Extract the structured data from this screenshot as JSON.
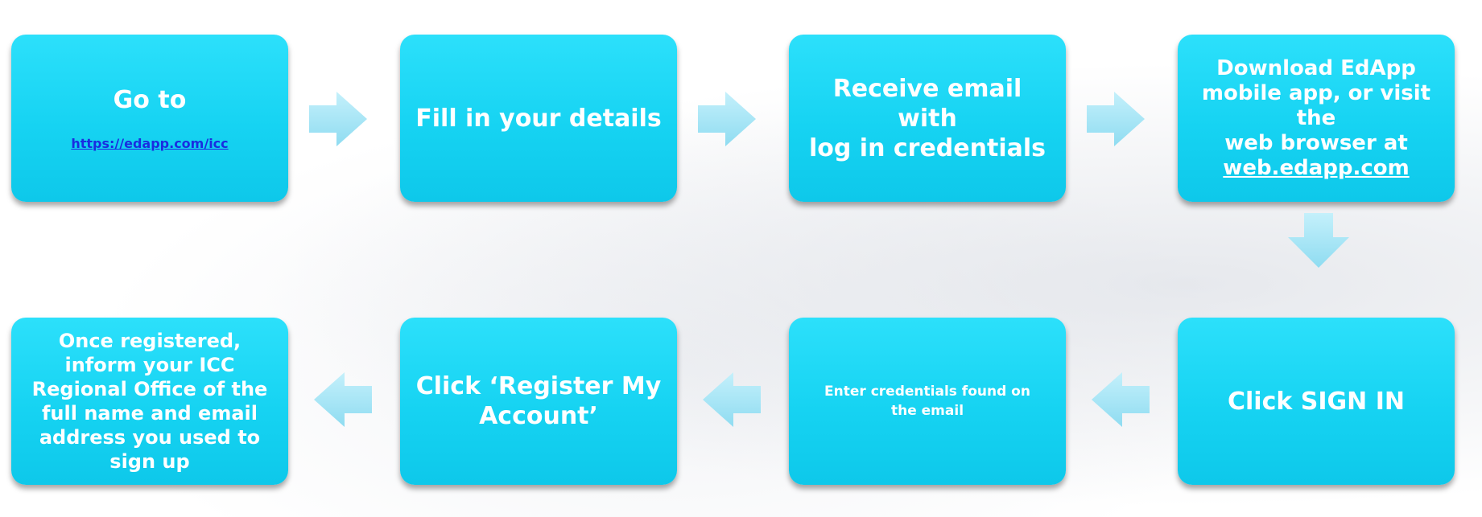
{
  "steps": {
    "go_to": {
      "title": "Go to",
      "link": "https://edapp.com/icc"
    },
    "fill": {
      "text": "Fill in your details"
    },
    "receive": {
      "line1": "Receive email with",
      "line2": "log in credentials"
    },
    "download": {
      "line1": "Download EdApp",
      "line2": "mobile app, or visit the",
      "line3": "web browser at",
      "link": "web.edapp.com"
    },
    "sign_in": {
      "text": "Click SIGN IN"
    },
    "enter": {
      "line1": "Enter credentials found on",
      "line2": "the email"
    },
    "register": {
      "line1": "Click ‘Register My",
      "line2": "Account’"
    },
    "inform": {
      "line1": "Once registered,",
      "line2": "inform your ICC",
      "line3": "Regional Office of the",
      "line4": "full name and email",
      "line5": "address you used to",
      "line6": "sign up"
    }
  },
  "colors": {
    "box": "#18d4f3",
    "arrow": "#a6e6f6",
    "link": "#1a2de0"
  },
  "icons": [
    "arrow-right-icon",
    "arrow-down-icon",
    "arrow-left-icon"
  ]
}
